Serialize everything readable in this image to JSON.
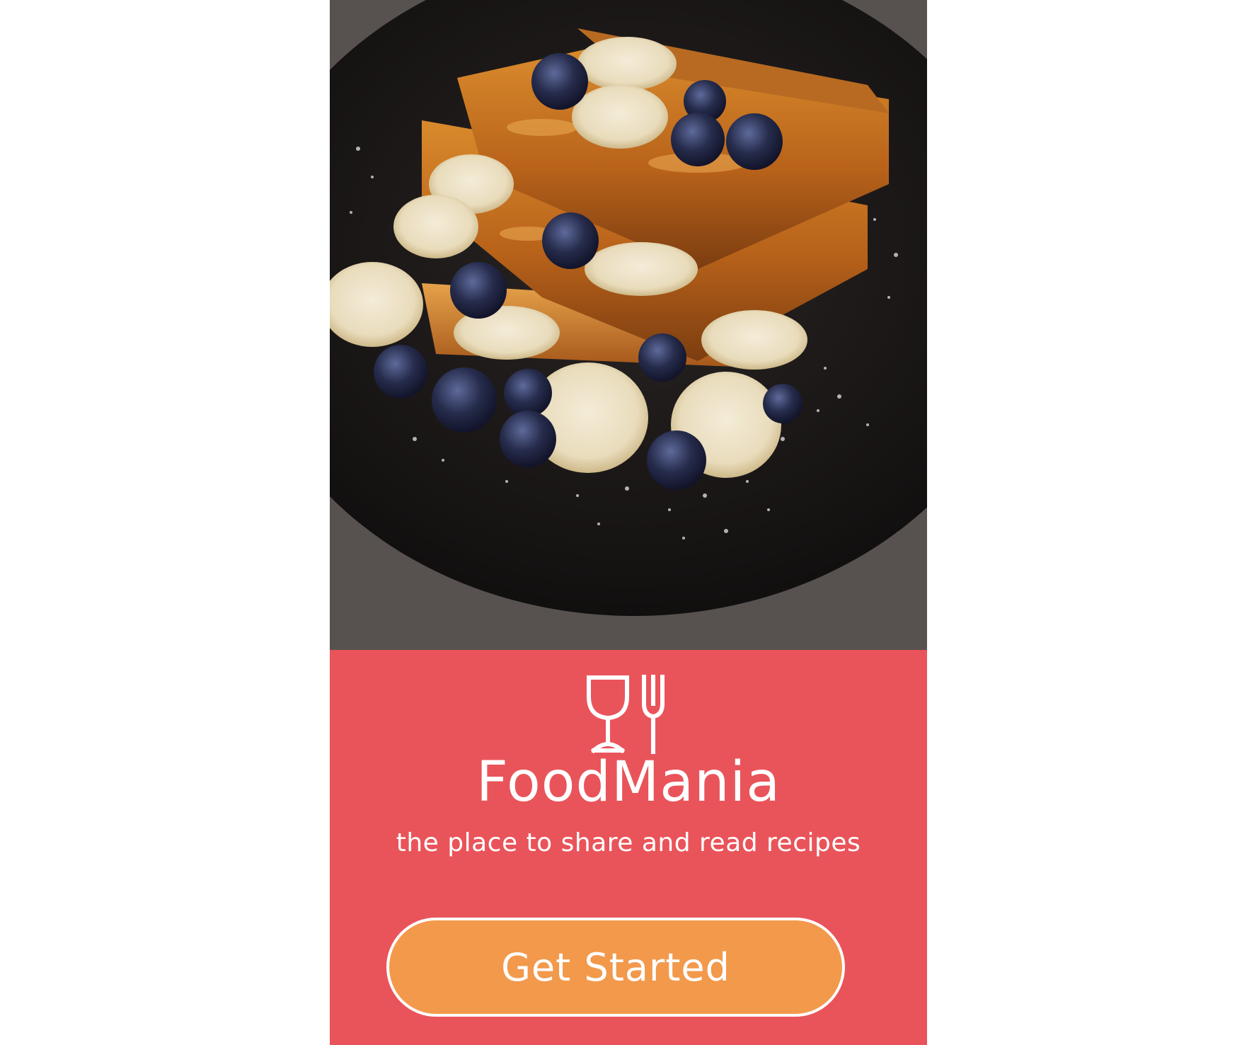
{
  "app": {
    "title": "FoodMania",
    "tagline": "the place to share and read recipes"
  },
  "hero": {
    "image": "french-toast-with-blueberries-and-banana-photo"
  },
  "logo": {
    "icon": "glass-and-fork-icon"
  },
  "cta": {
    "label": "Get Started"
  },
  "colors": {
    "panel": "#e9545a",
    "button": "#f2994c",
    "text": "#ffffff"
  }
}
